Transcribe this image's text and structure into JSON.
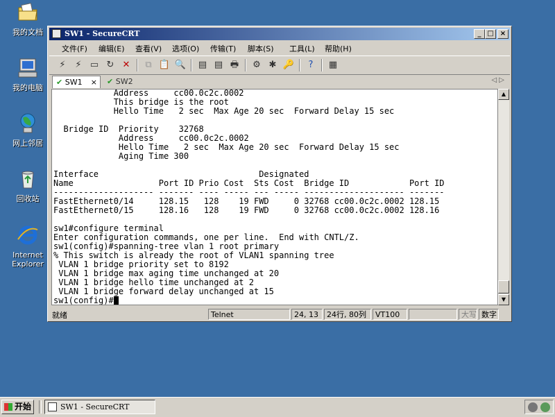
{
  "desktop": {
    "icons": [
      {
        "label": "我的文档",
        "icon": "my-documents-icon"
      },
      {
        "label": "我的电脑",
        "icon": "my-computer-icon"
      },
      {
        "label": "网上邻居",
        "icon": "network-places-icon"
      },
      {
        "label": "回收站",
        "icon": "recycle-bin-icon"
      },
      {
        "label_lines": [
          "Internet",
          "Explorer"
        ],
        "icon": "internet-explorer-icon"
      }
    ]
  },
  "window": {
    "title": "SW1 - SecureCRT",
    "controls": {
      "minimize": "_",
      "maximize": "□",
      "close": "×"
    },
    "menu": [
      "文件(F)",
      "编辑(E)",
      "查看(V)",
      "选项(O)",
      "传输(T)",
      "脚本(S)",
      "工具(L)",
      "帮助(H)"
    ],
    "tabs": [
      {
        "label": "SW1",
        "active": true,
        "close": "×"
      },
      {
        "label": "SW2",
        "active": false
      }
    ],
    "tab_nav": "◁ ▷"
  },
  "terminal": {
    "lines": [
      "            Address     cc00.0c2c.0002",
      "            This bridge is the root",
      "            Hello Time   2 sec  Max Age 20 sec  Forward Delay 15 sec",
      "",
      "  Bridge ID  Priority    32768",
      "             Address     cc00.0c2c.0002",
      "             Hello Time   2 sec  Max Age 20 sec  Forward Delay 15 sec",
      "             Aging Time 300",
      "",
      "Interface                                Designated",
      "Name                 Port ID Prio Cost  Sts Cost  Bridge ID            Port ID",
      "-------------------- ------- ---- ----- --- ----- -------------------- -------",
      "FastEthernet0/14     128.15   128    19 FWD     0 32768 cc00.0c2c.0002 128.15",
      "FastEthernet0/15     128.16   128    19 FWD     0 32768 cc00.0c2c.0002 128.16",
      "",
      "sw1#configure terminal",
      "Enter configuration commands, one per line.  End with CNTL/Z.",
      "sw1(config)#spanning-tree vlan 1 root primary",
      "% This switch is already the root of VLAN1 spanning tree",
      " VLAN 1 bridge priority set to 8192",
      " VLAN 1 bridge max aging time unchanged at 20",
      " VLAN 1 bridge hello time unchanged at 2",
      " VLAN 1 bridge forward delay unchanged at 15"
    ],
    "prompt": "sw1(config)#"
  },
  "statusbar": {
    "ready": "就绪",
    "protocol": "Telnet",
    "cursor_pos": "24, 13",
    "size": "24行, 80列",
    "emulation": "VT100",
    "blank": "",
    "caps": "大写",
    "num": "数字"
  },
  "taskbar": {
    "start": "开始",
    "task": "SW1 - SecureCRT"
  }
}
